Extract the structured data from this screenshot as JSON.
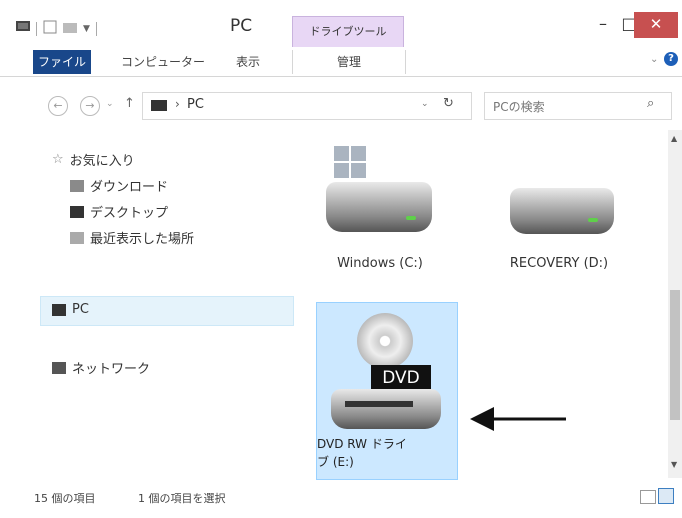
{
  "window": {
    "title": "PC",
    "tool_tab": "ドライブツール",
    "buttons": {
      "minimize": "–",
      "maximize": "□",
      "close": "✕"
    }
  },
  "ribbon": {
    "tabs": [
      {
        "label": "ファイル",
        "selected": true
      },
      {
        "label": "コンピューター",
        "selected": false
      },
      {
        "label": "表示",
        "selected": false
      },
      {
        "label": "管理",
        "selected": false
      }
    ],
    "collapse": "⌄",
    "help": "?"
  },
  "address": {
    "back": "←",
    "forward": "→",
    "recent": "⌄",
    "up": "↑",
    "separator": "›",
    "path": "PC",
    "dropdown": "⌄",
    "refresh": "↻"
  },
  "search": {
    "placeholder": "PCの検索",
    "icon": "search-icon",
    "icon_glyph": "⌕"
  },
  "nav": {
    "favorites": "お気に入り",
    "items": [
      {
        "label": "ダウンロード",
        "icon": "download-folder-icon"
      },
      {
        "label": "デスクトップ",
        "icon": "desktop-folder-icon"
      },
      {
        "label": "最近表示した場所",
        "icon": "recent-places-icon"
      }
    ],
    "pc": "PC",
    "network": "ネットワーク"
  },
  "drives": [
    {
      "label": "Windows (C:)",
      "icon": "windows-drive-icon"
    },
    {
      "label": "RECOVERY (D:)",
      "icon": "hard-drive-icon"
    }
  ],
  "dvd": {
    "badge": "DVD",
    "label_line1": "DVD RW ドライ",
    "label_line2": "ブ (E:)",
    "icon": "dvd-drive-icon",
    "selected": true
  },
  "status": {
    "count": "15 個の項目",
    "selected": "1 個の項目を選択"
  },
  "colors": {
    "file_tab": "#19478a",
    "tool_tab": "#e8d7f5",
    "selection": "#cce8ff",
    "close": "#c75050"
  }
}
